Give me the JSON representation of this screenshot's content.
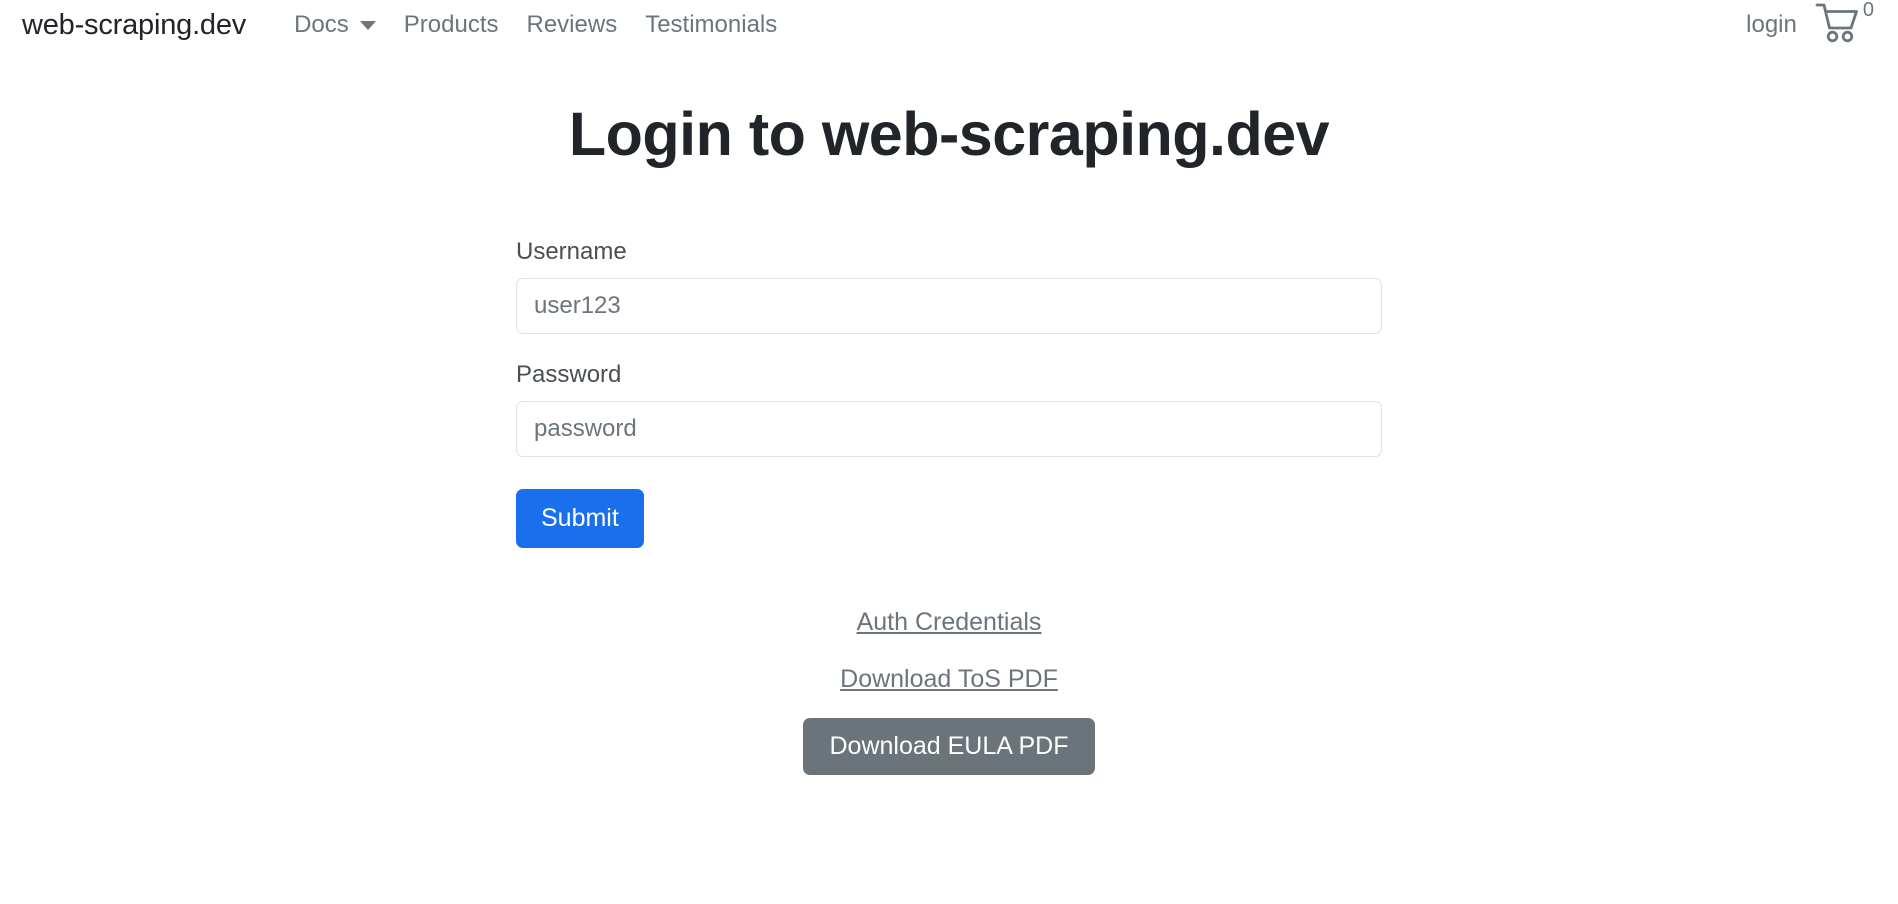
{
  "navbar": {
    "brand": "web-scraping.dev",
    "items": [
      {
        "label": "Docs",
        "has_caret": true,
        "icon": "chevron-down-icon"
      },
      {
        "label": "Products",
        "has_caret": false
      },
      {
        "label": "Reviews",
        "has_caret": false
      },
      {
        "label": "Testimonials",
        "has_caret": false
      }
    ],
    "login_label": "login",
    "cart": {
      "icon": "shopping-cart-icon",
      "count": "0"
    }
  },
  "page": {
    "title": "Login to web-scraping.dev"
  },
  "form": {
    "username": {
      "label": "Username",
      "placeholder": "user123",
      "value": ""
    },
    "password": {
      "label": "Password",
      "placeholder": "password",
      "value": ""
    },
    "submit_label": "Submit"
  },
  "footer": {
    "auth_credentials_label": "Auth Credentials",
    "tos_label": "Download ToS PDF",
    "eula_label": "Download EULA PDF"
  },
  "colors": {
    "primary": "#1a6fed",
    "secondary": "#6b747b",
    "muted_text": "#6c757d",
    "body_text": "#212529",
    "border": "#dee2e6",
    "background": "#ffffff"
  }
}
